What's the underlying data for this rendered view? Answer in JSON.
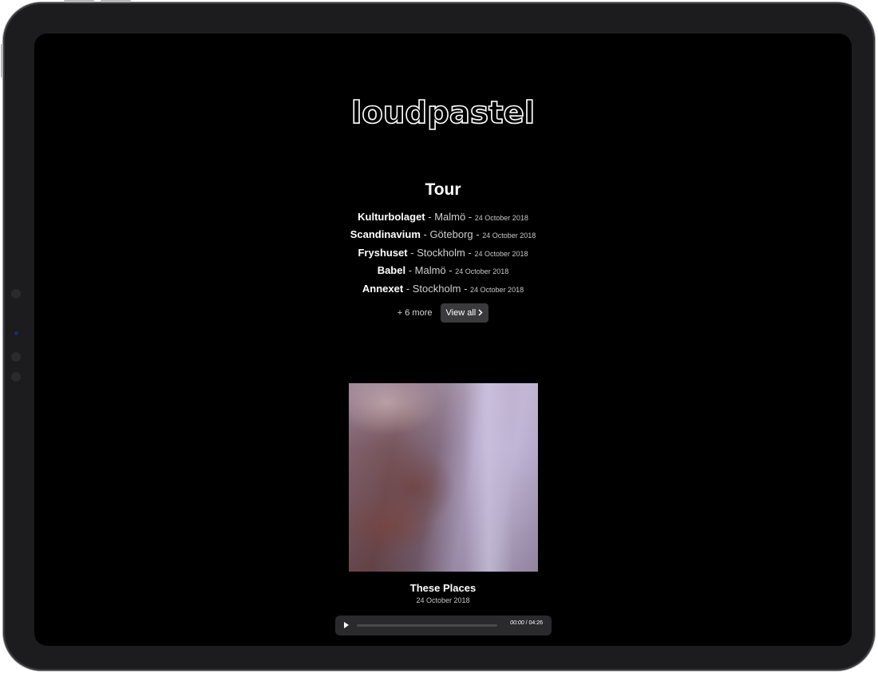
{
  "logo": {
    "text": "loudpastel",
    "icon": "loudpastel-wordmark-logo"
  },
  "tour": {
    "title": "Tour",
    "separator": " - ",
    "events": [
      {
        "venue": "Kulturbolaget",
        "city": "Malmö",
        "date": "24 October 2018"
      },
      {
        "venue": "Scandinavium",
        "city": "Göteborg",
        "date": "24 October 2018"
      },
      {
        "venue": "Fryshuset",
        "city": "Stockholm",
        "date": "24 October 2018"
      },
      {
        "venue": "Babel",
        "city": "Malmö",
        "date": "24 October 2018"
      },
      {
        "venue": "Annexet",
        "city": "Stockholm",
        "date": "24 October 2018"
      }
    ],
    "more_text": "+ 6 more",
    "view_all_label": "View all",
    "view_all_icon": "chevron-right-icon"
  },
  "release": {
    "title": "These Places",
    "date": "24 October 2018",
    "cover_image": "album-cover-blurred-room"
  },
  "player": {
    "play_icon": "play-icon",
    "current_time": "00:00",
    "time_separator": " / ",
    "duration": "04:26",
    "progress": 0
  },
  "colors": {
    "screen_background": "#000000",
    "device_bezel": "#1c1c1e",
    "player_background": "#2a2a2c",
    "button_background": "#3a3a3c",
    "text_primary": "#ffffff",
    "text_secondary": "#c8c8c8"
  }
}
